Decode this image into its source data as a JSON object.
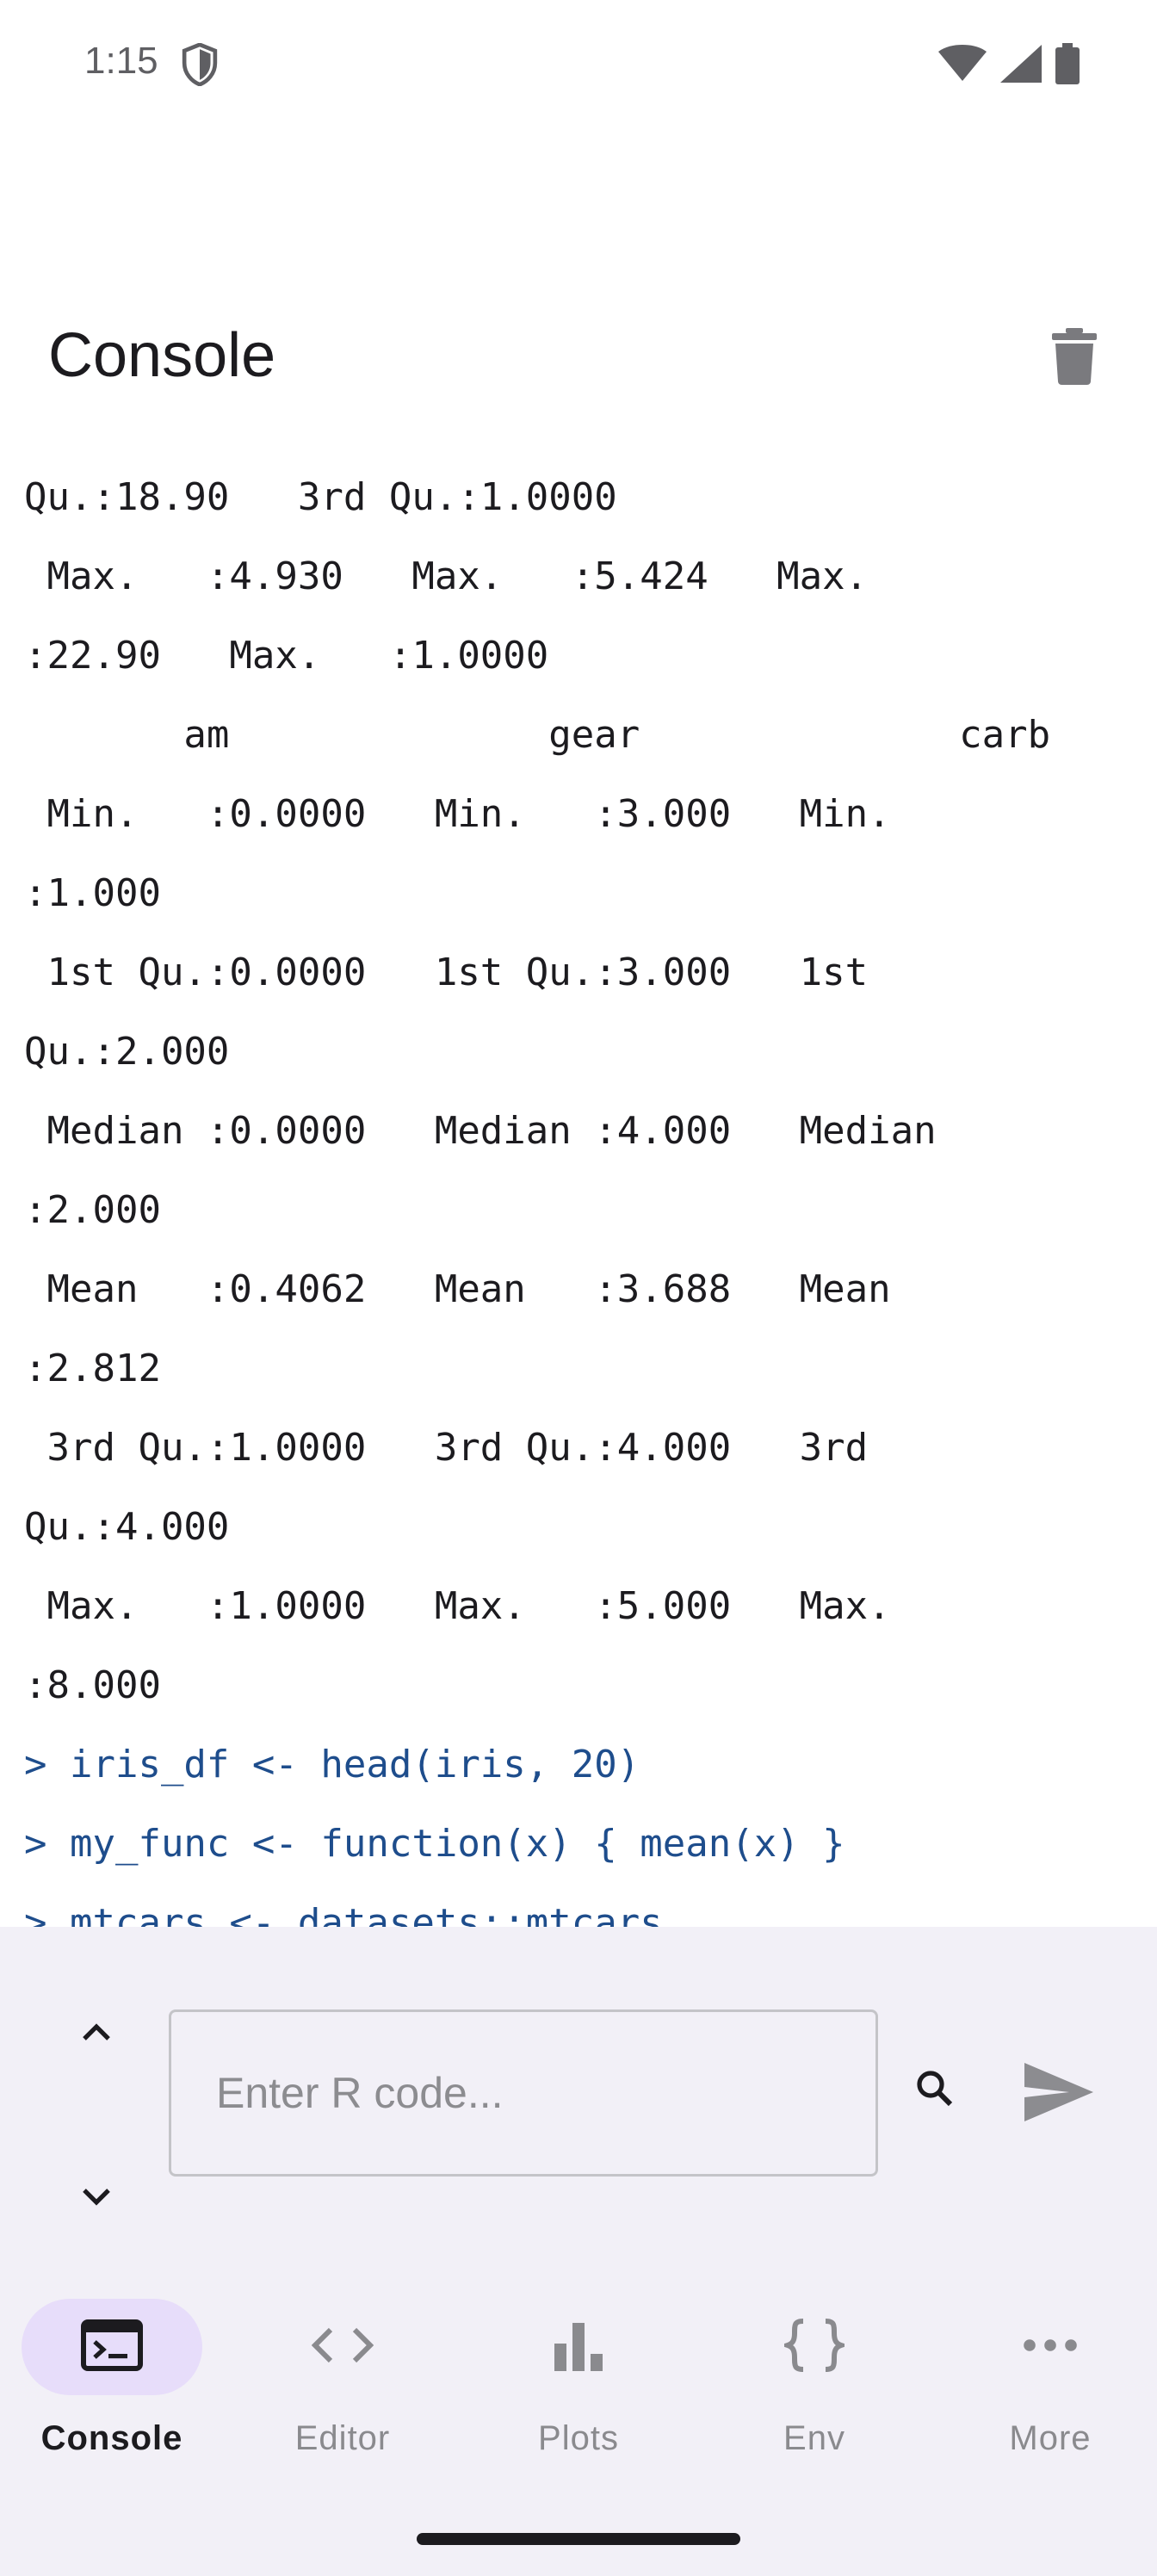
{
  "status_bar": {
    "time": "1:15"
  },
  "header": {
    "title": "Console"
  },
  "console": {
    "lines": [
      {
        "text": "Qu.:18.90   3rd Qu.:1.0000",
        "kind": "output"
      },
      {
        "text": " Max.   :4.930   Max.   :5.424   Max.",
        "kind": "output"
      },
      {
        "text": ":22.90   Max.   :1.0000",
        "kind": "output"
      },
      {
        "text": "       am              gear              carb",
        "kind": "output"
      },
      {
        "text": " Min.   :0.0000   Min.   :3.000   Min.",
        "kind": "output"
      },
      {
        "text": ":1.000",
        "kind": "output"
      },
      {
        "text": " 1st Qu.:0.0000   1st Qu.:3.000   1st",
        "kind": "output"
      },
      {
        "text": "Qu.:2.000",
        "kind": "output"
      },
      {
        "text": " Median :0.0000   Median :4.000   Median",
        "kind": "output"
      },
      {
        "text": ":2.000",
        "kind": "output"
      },
      {
        "text": " Mean   :0.4062   Mean   :3.688   Mean",
        "kind": "output"
      },
      {
        "text": ":2.812",
        "kind": "output"
      },
      {
        "text": " 3rd Qu.:1.0000   3rd Qu.:4.000   3rd",
        "kind": "output"
      },
      {
        "text": "Qu.:4.000",
        "kind": "output"
      },
      {
        "text": " Max.   :1.0000   Max.   :5.000   Max.",
        "kind": "output"
      },
      {
        "text": ":8.000",
        "kind": "output"
      },
      {
        "text": "> iris_df <- head(iris, 20)",
        "kind": "command"
      },
      {
        "text": "> my_func <- function(x) { mean(x) }",
        "kind": "command"
      },
      {
        "text": "> mtcars <- datasets::mtcars",
        "kind": "command"
      }
    ]
  },
  "input": {
    "placeholder": "Enter R code..."
  },
  "nav": {
    "items": [
      {
        "label": "Console",
        "icon": "terminal-icon",
        "active": true
      },
      {
        "label": "Editor",
        "icon": "code-icon",
        "active": false
      },
      {
        "label": "Plots",
        "icon": "bar-chart-icon",
        "active": false
      },
      {
        "label": "Env",
        "icon": "braces-icon",
        "active": false
      },
      {
        "label": "More",
        "icon": "more-horizontal-icon",
        "active": false
      }
    ]
  },
  "colors": {
    "accent_pill": "#e7ddfa",
    "command_text": "#1e4d8c",
    "panel_background": "#f2f0f7"
  }
}
